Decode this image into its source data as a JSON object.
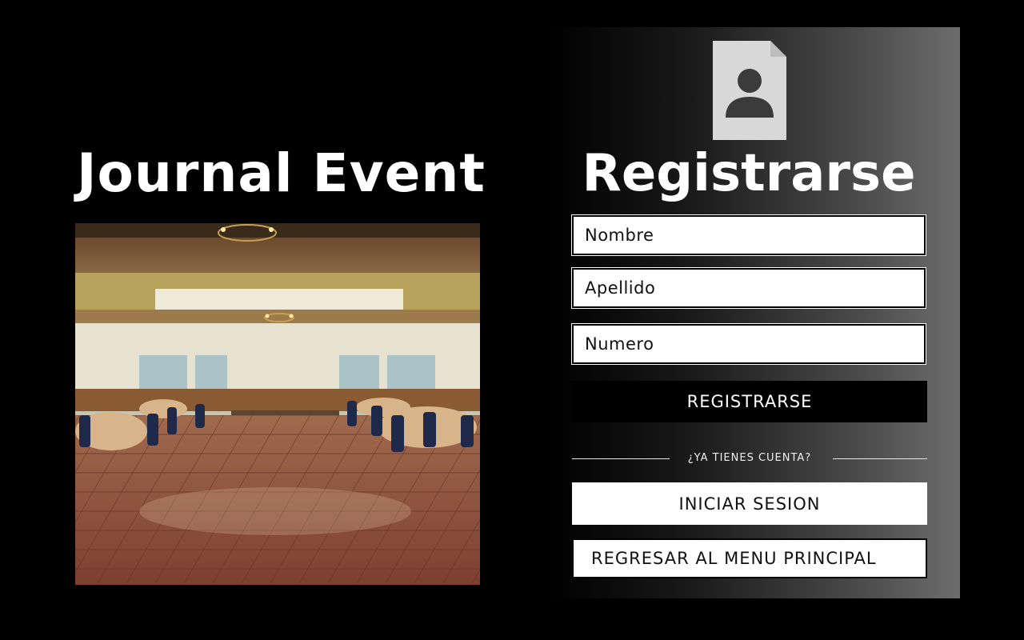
{
  "brand": {
    "title": "Journal Event"
  },
  "form": {
    "title": "Registrarse",
    "fields": [
      {
        "placeholder": "Nombre"
      },
      {
        "placeholder": "Apellido"
      },
      {
        "placeholder": "Numero"
      }
    ],
    "register_label": "REGISTRARSE",
    "divider_text": "¿YA TIENES CUENTA?",
    "login_label": "INICIAR SESION",
    "back_label": "REGRESAR AL MENU PRINCIPAL"
  },
  "icons": {
    "avatar": "user-file-icon"
  }
}
